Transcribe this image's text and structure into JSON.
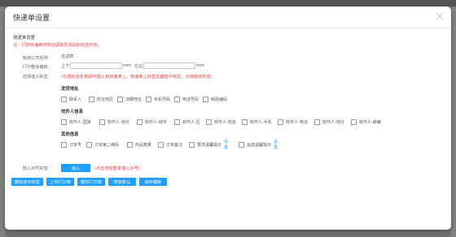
{
  "dialog": {
    "title": "快递单设置"
  },
  "section_title": "快递单设置",
  "note": "注：打印快递单时将动调取您添加的标签内容。",
  "fields": {
    "company_label": "物流公司名称：",
    "company_value": "在这样",
    "offset_label": "打印整体偏移：",
    "offset_top_prefix": "上下：",
    "offset_unit1": "mm",
    "offset_left_prefix": "左右：",
    "offset_unit2": "mm",
    "insert_tag_label": "选择插入标签：",
    "insert_tag_hint": "(勾选标签名称即可插入到快递单上，快递单上标签左键选中标签，长按拖动标签)"
  },
  "groups": [
    {
      "title": "发货地址",
      "items": [
        {
          "label": "联系人"
        },
        {
          "label": "所在地区"
        },
        {
          "label": "详细地址"
        },
        {
          "label": "手机号码"
        },
        {
          "label": "电话号码"
        },
        {
          "label": "邮政编码"
        }
      ]
    },
    {
      "title": "收件人信息",
      "items": [
        {
          "label": "收件人-国家"
        },
        {
          "label": "收件人-省份"
        },
        {
          "label": "收件人-城市"
        },
        {
          "label": "收件人-区"
        },
        {
          "label": "收件人-姓名"
        },
        {
          "label": "收件人-手机"
        },
        {
          "label": "收件人-电话"
        },
        {
          "label": "收件人-地址"
        },
        {
          "label": "收件人-邮编"
        }
      ]
    },
    {
      "title": "其他信息",
      "items": [
        {
          "label": "订单号"
        },
        {
          "label": "订单第二维码"
        },
        {
          "label": "商品数量"
        },
        {
          "label": "订单备注"
        },
        {
          "label": "要求温馨提示",
          "link": "设置"
        },
        {
          "label": "运送温馨提示",
          "link": "设置"
        }
      ]
    }
  ],
  "insert_row": {
    "label": "插入对号标签：",
    "button": "插入",
    "hint": "(点击按钮重复插入对号)"
  },
  "actions": {
    "delete_selected": "删除选中标签",
    "upload_bg": "上传打印单",
    "delete_bg": "删除打印单",
    "restore_default": "恢复默认",
    "save_template": "保存模板"
  },
  "colors": {
    "primary": "#1e9fff",
    "danger": "#e4393c",
    "overlay": "#6f6f6f"
  },
  "icons": {
    "close": "close-icon"
  }
}
